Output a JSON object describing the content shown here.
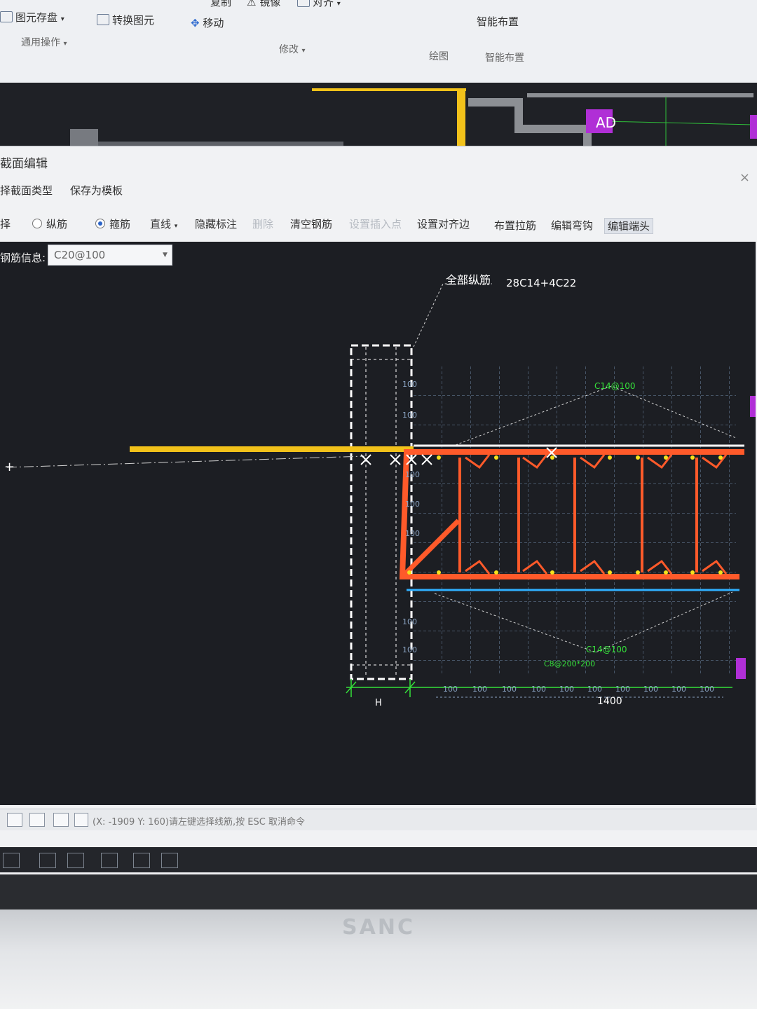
{
  "ribbon": {
    "save_label": "图元存盘",
    "convert_label": "转换图元",
    "move_label": "移动",
    "mirror_label": "镜像",
    "align_label": "对齐",
    "copy_label": "复制",
    "common_ops": "通用操作",
    "modify_group": "修改",
    "draw_group": "绘图",
    "smart_layout": "智能布置",
    "smart_layout_group": "智能布置"
  },
  "bg_label": "AD",
  "dialog": {
    "title": "截面编辑",
    "menu_select_type": "择截面类型",
    "menu_save_template": "保存为模板",
    "close_icon": "×"
  },
  "toolbar": {
    "select": "择",
    "longitudinal": "纵筋",
    "stirrup": "箍筋",
    "line": "直线",
    "hide_label": "隐藏标注",
    "delete": "删除",
    "clear_rebar": "清空钢筋",
    "set_insert": "设置插入点",
    "set_align_edge": "设置对齐边",
    "layout_tie": "布置拉筋",
    "edit_hook": "编辑弯钩",
    "edit_end": "编辑端头"
  },
  "rebar_info": {
    "label": "钢筋信息:",
    "value": "C20@100"
  },
  "drawing": {
    "all_long_label": "全部纵筋",
    "all_long_value": "28C14+4C22",
    "top_dist": "C14@100",
    "bottom_dist": "C14@100",
    "tie_label": "C8@200*200",
    "width_label": "H",
    "total_dim": "1400",
    "spacing": "100"
  },
  "status": {
    "text": "(X: -1909 Y: 160)请左键选择线筋,按 ESC 取消命令"
  },
  "monitor": {
    "brand": "SANC"
  },
  "colors": {
    "rebar": "#ff5a2a",
    "slab_line": "#f2c21a",
    "dimension": "#35e03a",
    "grid": "#6f8aa8",
    "canvas_bg": "#1c1e23"
  }
}
